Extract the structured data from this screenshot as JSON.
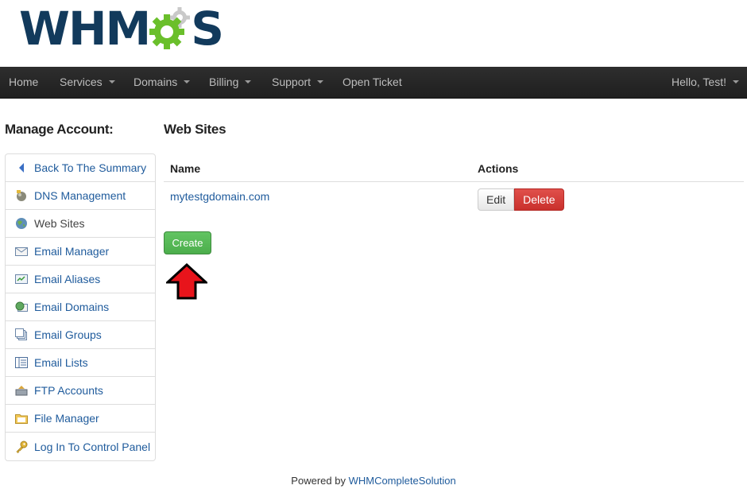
{
  "logo": {
    "text_left": "WHM",
    "text_right": "S",
    "gear_colors": {
      "green": "#6abf2b",
      "gray": "#c9c9c9"
    }
  },
  "navbar": {
    "items": [
      {
        "label": "Home",
        "has_caret": false
      },
      {
        "label": "Services",
        "has_caret": true
      },
      {
        "label": "Domains",
        "has_caret": true
      },
      {
        "label": "Billing",
        "has_caret": true
      },
      {
        "label": "Support",
        "has_caret": true
      },
      {
        "label": "Open Ticket",
        "has_caret": false
      }
    ],
    "user": {
      "label": "Hello, Test!",
      "has_caret": true
    }
  },
  "sidebar": {
    "title": "Manage Account:",
    "items": [
      {
        "label": "Back To The Summary",
        "icon": "back-arrow-icon"
      },
      {
        "label": "DNS Management",
        "icon": "dns-icon"
      },
      {
        "label": "Web Sites",
        "icon": "globe-icon",
        "active": true
      },
      {
        "label": "Email Manager",
        "icon": "envelope-icon"
      },
      {
        "label": "Email Aliases",
        "icon": "email-alias-icon"
      },
      {
        "label": "Email Domains",
        "icon": "email-domain-icon"
      },
      {
        "label": "Email Groups",
        "icon": "email-groups-icon"
      },
      {
        "label": "Email Lists",
        "icon": "email-list-icon"
      },
      {
        "label": "FTP Accounts",
        "icon": "ftp-icon"
      },
      {
        "label": "File Manager",
        "icon": "folder-icon"
      },
      {
        "label": "Log In To Control Panel",
        "icon": "key-icon"
      }
    ]
  },
  "main": {
    "title": "Web Sites",
    "table": {
      "headers": {
        "name": "Name",
        "actions": "Actions"
      },
      "rows": [
        {
          "name": "mytestgdomain.com",
          "edit_label": "Edit",
          "delete_label": "Delete"
        }
      ]
    },
    "create_label": "Create",
    "annotation_arrow": {
      "color": "#e8141b",
      "direction": "up"
    }
  },
  "footer": {
    "prefix": "Powered by",
    "link": "WHMCompleteSolution"
  }
}
